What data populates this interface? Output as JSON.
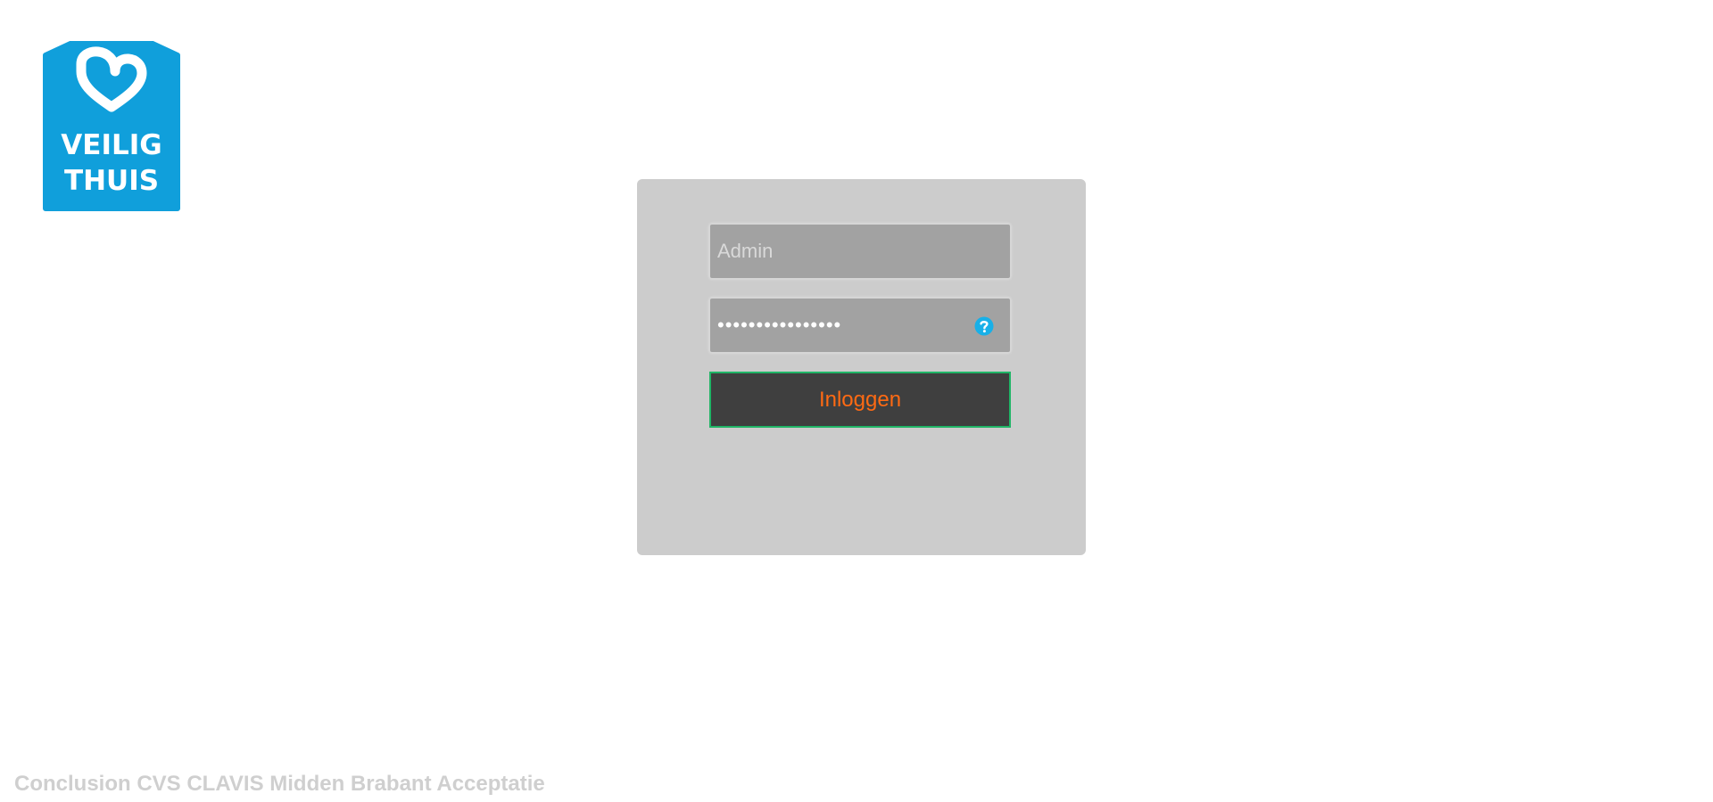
{
  "brand": {
    "logo_line1": "VEILIG",
    "logo_line2": "THUIS",
    "logo_color": "#109fdb"
  },
  "login": {
    "username_placeholder": "Admin",
    "username_value": "",
    "password_value": "••••••••••••••••",
    "help_icon": "question-circle-icon",
    "submit_label": "Inloggen"
  },
  "footer": {
    "text": "Conclusion CVS CLAVIS Midden Brabant Acceptatie"
  },
  "colors": {
    "panel": "#cccccc",
    "field": "#a2a2a2",
    "button": "#3f3f3f",
    "button_border": "#1fb566",
    "button_text": "#ff6a13",
    "help_icon": "#18b0e8",
    "footer_text": "#cfcfcf"
  }
}
